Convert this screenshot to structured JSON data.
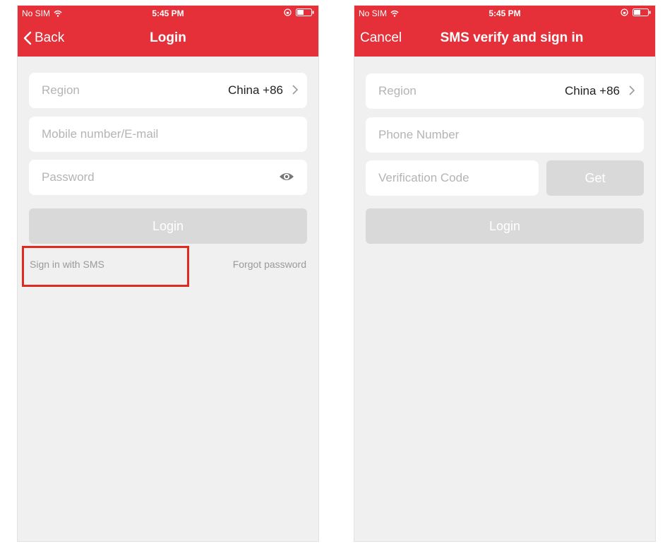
{
  "status_bar": {
    "carrier": "No SIM",
    "time": "5:45 PM"
  },
  "left_screen": {
    "nav": {
      "back_label": "Back",
      "title": "Login"
    },
    "region": {
      "label": "Region",
      "value": "China +86"
    },
    "account_field": {
      "placeholder": "Mobile number/E-mail"
    },
    "password_field": {
      "placeholder": "Password"
    },
    "login_button": "Login",
    "sms_link": "Sign in with SMS",
    "forgot_link": "Forgot password"
  },
  "right_screen": {
    "nav": {
      "cancel_label": "Cancel",
      "title": "SMS verify and sign in"
    },
    "region": {
      "label": "Region",
      "value": "China +86"
    },
    "phone_field": {
      "placeholder": "Phone Number"
    },
    "code_field": {
      "placeholder": "Verification Code"
    },
    "get_button": "Get",
    "login_button": "Login"
  },
  "colors": {
    "brand_red": "#e5303a",
    "background": "#f0f0f0",
    "disabled_button": "#d9d9d9",
    "highlight_box": "#e02a1f"
  },
  "icons": [
    "wifi-icon",
    "rotation-lock-icon",
    "battery-icon",
    "chevron-left-icon",
    "chevron-right-icon",
    "eye-icon"
  ]
}
